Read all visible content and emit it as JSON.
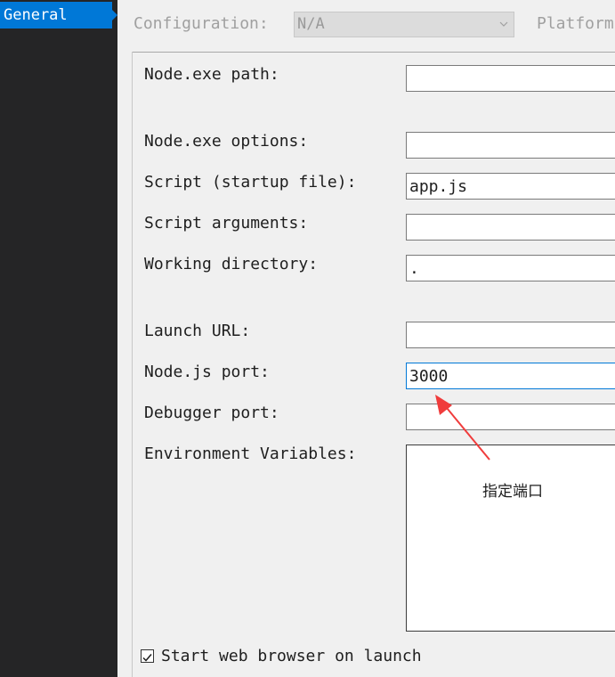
{
  "sidebar": {
    "items": [
      {
        "label": "General",
        "selected": true
      }
    ]
  },
  "toolbar": {
    "configuration_label": "Configuration:",
    "configuration_value": "N/A",
    "platform_label": "Platform"
  },
  "form": {
    "node_exe_path": {
      "label": "Node.exe path:",
      "value": ""
    },
    "node_exe_options": {
      "label": "Node.exe options:",
      "value": ""
    },
    "script": {
      "label": "Script (startup file):",
      "value": "app.js"
    },
    "script_arguments": {
      "label": "Script arguments:",
      "value": ""
    },
    "working_directory": {
      "label": "Working directory:",
      "value": "."
    },
    "launch_url": {
      "label": "Launch URL:",
      "value": ""
    },
    "nodejs_port": {
      "label": "Node.js port:",
      "value": "3000"
    },
    "debugger_port": {
      "label": "Debugger port:",
      "value": ""
    },
    "environment_variables": {
      "label": "Environment Variables:",
      "value": ""
    },
    "start_browser": {
      "label": "Start web browser on launch",
      "checked": true
    }
  },
  "annotation": {
    "text": "指定端口",
    "color": "#f03c3c"
  },
  "colors": {
    "accent": "#0078d7",
    "sidebar_bg": "#252526",
    "panel_bg": "#f0f0f0"
  }
}
